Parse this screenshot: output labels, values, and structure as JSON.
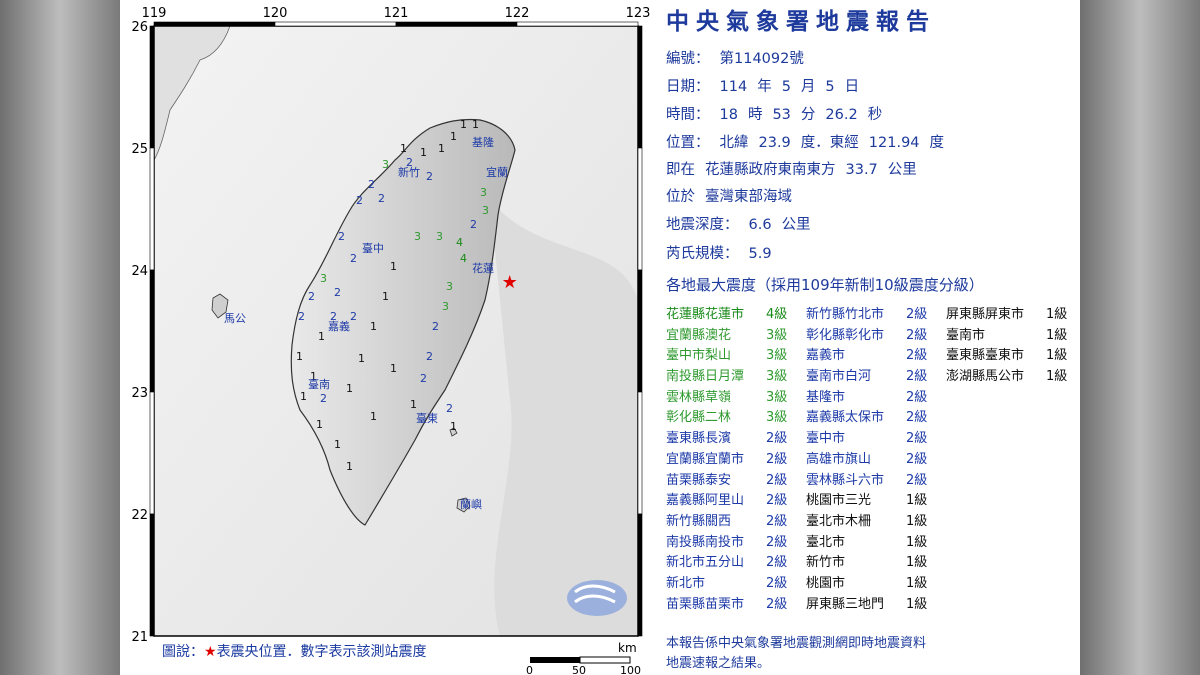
{
  "header": {
    "title": "中央氣象署地震報告"
  },
  "report": {
    "number_label": "編號：",
    "number": "第114092號",
    "date_label": "日期：",
    "date_year": "114",
    "year_unit": "年",
    "date_month": "5",
    "month_unit": "月",
    "date_day": "5",
    "day_unit": "日",
    "time_label": "時間：",
    "hour": "18",
    "hour_unit": "時",
    "minute": "53",
    "minute_unit": "分",
    "second": "26.2",
    "second_unit": "秒",
    "location_label": "位置：",
    "lat_prefix": "北緯",
    "lat": "23.9",
    "lat_unit": "度．東經",
    "lon": "121.94",
    "lon_unit": "度",
    "relative_label": "即在",
    "relative_text": "花蓮縣政府東南東方",
    "relative_dist": "33.7",
    "relative_unit": "公里",
    "region_label": "位於",
    "region": "臺灣東部海域",
    "depth_label": "地震深度：",
    "depth": "6.6",
    "depth_unit": "公里",
    "magnitude_label": "芮氏規模：",
    "magnitude": "5.9",
    "intensity_title": "各地最大震度（採用109年新制10級震度分級）",
    "footer_line1": "本報告係中央氣象署地震觀測網即時地震資料",
    "footer_line2": "地震速報之結果。"
  },
  "intensity_columns": [
    [
      {
        "name": "花蓮縣花蓮市",
        "level": "4級",
        "c": "c4"
      },
      {
        "name": "宜蘭縣澳花",
        "level": "3級",
        "c": "c3"
      },
      {
        "name": "臺中市梨山",
        "level": "3級",
        "c": "c3"
      },
      {
        "name": "南投縣日月潭",
        "level": "3級",
        "c": "c3"
      },
      {
        "name": "雲林縣草嶺",
        "level": "3級",
        "c": "c3"
      },
      {
        "name": "彰化縣二林",
        "level": "3級",
        "c": "c3"
      },
      {
        "name": "臺東縣長濱",
        "level": "2級",
        "c": "c2"
      },
      {
        "name": "宜蘭縣宜蘭市",
        "level": "2級",
        "c": "c2"
      },
      {
        "name": "苗栗縣泰安",
        "level": "2級",
        "c": "c2"
      },
      {
        "name": "嘉義縣阿里山",
        "level": "2級",
        "c": "c2"
      },
      {
        "name": "新竹縣關西",
        "level": "2級",
        "c": "c2"
      },
      {
        "name": "南投縣南投市",
        "level": "2級",
        "c": "c2"
      },
      {
        "name": "新北市五分山",
        "level": "2級",
        "c": "c2"
      },
      {
        "name": "新北市",
        "level": "2級",
        "c": "c2"
      },
      {
        "name": "苗栗縣苗栗市",
        "level": "2級",
        "c": "c2"
      }
    ],
    [
      {
        "name": "新竹縣竹北市",
        "level": "2級",
        "c": "c2"
      },
      {
        "name": "彰化縣彰化市",
        "level": "2級",
        "c": "c2"
      },
      {
        "name": "嘉義市",
        "level": "2級",
        "c": "c2"
      },
      {
        "name": "臺南市白河",
        "level": "2級",
        "c": "c2"
      },
      {
        "name": "基隆市",
        "level": "2級",
        "c": "c2"
      },
      {
        "name": "嘉義縣太保市",
        "level": "2級",
        "c": "c2"
      },
      {
        "name": "臺中市",
        "level": "2級",
        "c": "c2"
      },
      {
        "name": "高雄市旗山",
        "level": "2級",
        "c": "c2"
      },
      {
        "name": "雲林縣斗六市",
        "level": "2級",
        "c": "c2"
      },
      {
        "name": "桃園市三光",
        "level": "1級",
        "c": "c1"
      },
      {
        "name": "臺北市木柵",
        "level": "1級",
        "c": "c1"
      },
      {
        "name": "臺北市",
        "level": "1級",
        "c": "c1"
      },
      {
        "name": "新竹市",
        "level": "1級",
        "c": "c1"
      },
      {
        "name": "桃園市",
        "level": "1級",
        "c": "c1"
      },
      {
        "name": "屏東縣三地門",
        "level": "1級",
        "c": "c1"
      }
    ],
    [
      {
        "name": "屏東縣屏東市",
        "level": "1級",
        "c": "c1"
      },
      {
        "name": "臺南市",
        "level": "1級",
        "c": "c1"
      },
      {
        "name": "臺東縣臺東市",
        "level": "1級",
        "c": "c1"
      },
      {
        "name": "澎湖縣馬公市",
        "level": "1級",
        "c": "c1"
      }
    ]
  ],
  "map": {
    "lon_ticks": [
      "119",
      "120",
      "121",
      "122",
      "123"
    ],
    "lat_ticks": [
      "26",
      "25",
      "24",
      "23",
      "22",
      "21"
    ],
    "city_labels": [
      "基隆",
      "新竹",
      "宜蘭",
      "臺中",
      "花蓮",
      "馬公",
      "嘉義",
      "臺南",
      "臺東",
      "蘭嶼"
    ],
    "epicenter": {
      "lon": 121.94,
      "lat": 23.9
    },
    "legend_prefix": "圖說：",
    "legend_star": "★",
    "legend_text": "表震央位置．數字表示該測站震度",
    "scale_unit": "km",
    "scale_ticks": [
      "0",
      "50",
      "100"
    ],
    "colors": {
      "level4": "#1a8a1a",
      "level3": "#2f9a2f",
      "level2": "#1d3aa8",
      "level1": "#111111",
      "epicenter": "#e00000"
    }
  }
}
